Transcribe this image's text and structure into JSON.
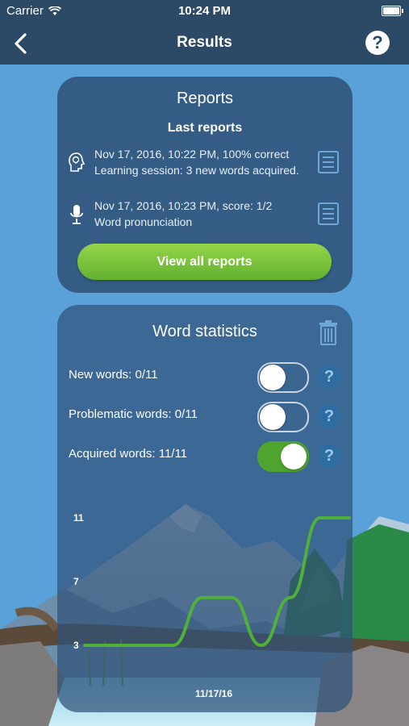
{
  "status_bar": {
    "carrier": "Carrier",
    "time": "10:24 PM"
  },
  "nav": {
    "title": "Results"
  },
  "reports": {
    "title": "Reports",
    "subtitle": "Last reports",
    "items": [
      {
        "line1": "Nov 17, 2016, 10:22 PM, 100% correct",
        "line2": "Learning session: 3 new words acquired.",
        "icon": "lightbulb-head-icon"
      },
      {
        "line1": "Nov 17, 2016, 10:23 PM, score: 1/2",
        "line2": "Word pronunciation",
        "icon": "microphone-icon"
      }
    ],
    "view_all_label": "View all reports"
  },
  "word_statistics": {
    "title": "Word statistics",
    "rows": [
      {
        "label": "New words: 0/11",
        "enabled": false
      },
      {
        "label": "Problematic words: 0/11",
        "enabled": false
      },
      {
        "label": "Acquired words: 11/11",
        "enabled": true
      }
    ]
  },
  "colors": {
    "accent_green": "#62b02f",
    "nav_bg": "#2c4a66"
  },
  "chart_data": {
    "type": "line",
    "x_tick_labels": [
      "11/17/16"
    ],
    "y_ticks": [
      3,
      7,
      11
    ],
    "ylim": [
      3,
      11
    ],
    "series": [
      {
        "values": [
          3,
          3,
          3,
          3,
          6,
          6,
          3,
          6,
          11,
          11
        ]
      }
    ]
  }
}
